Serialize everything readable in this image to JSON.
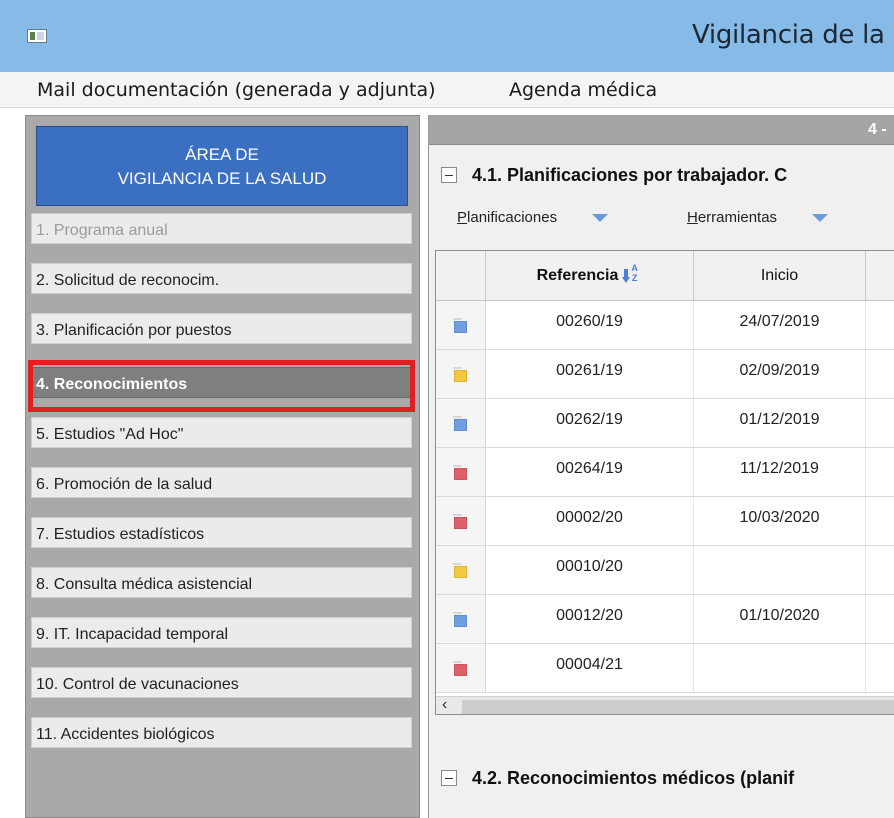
{
  "window": {
    "title": "Vigilancia de la"
  },
  "menu": [
    {
      "label": "Mail documentación (generada y adjunta)"
    },
    {
      "label": "Agenda médica"
    }
  ],
  "sidebar": {
    "header": {
      "line1": "ÁREA DE",
      "line2": "VIGILANCIA DE LA SALUD"
    },
    "items": [
      {
        "label": "1. Programa anual",
        "state": "disabled"
      },
      {
        "label": "2. Solicitud de reconocim.",
        "state": "normal"
      },
      {
        "label": "3. Planificación por puestos",
        "state": "normal"
      },
      {
        "label": "4. Reconocimientos",
        "state": "selected"
      },
      {
        "label": "5. Estudios \"Ad Hoc\"",
        "state": "normal"
      },
      {
        "label": "6. Promoción de la salud",
        "state": "normal"
      },
      {
        "label": "7. Estudios estadísticos",
        "state": "normal"
      },
      {
        "label": "8. Consulta médica asistencial",
        "state": "normal"
      },
      {
        "label": "9. IT. Incapacidad temporal",
        "state": "normal"
      },
      {
        "label": "10. Control de vacunaciones",
        "state": "normal"
      },
      {
        "label": "11. Accidentes biológicos",
        "state": "normal"
      }
    ],
    "highlight_color": "#e02020"
  },
  "main": {
    "header_text": "4 -",
    "section1": {
      "title": "4.1. Planificaciones por trabajador. C",
      "toolbar": [
        {
          "label": "Planificaciones",
          "accel": "P"
        },
        {
          "label": "Herramientas",
          "accel": "H"
        }
      ]
    },
    "grid": {
      "columns": [
        "Referencia",
        "Inicio"
      ],
      "sorted_column": "Referencia",
      "sort_icon": "sort-ascending-icon",
      "rows": [
        {
          "ref": "00260/19",
          "inicio": "24/07/2019",
          "color": "#6f9fe0"
        },
        {
          "ref": "00261/19",
          "inicio": "02/09/2019",
          "color": "#f5c842"
        },
        {
          "ref": "00262/19",
          "inicio": "01/12/2019",
          "color": "#6f9fe0"
        },
        {
          "ref": "00264/19",
          "inicio": "11/12/2019",
          "color": "#e0606a"
        },
        {
          "ref": "00002/20",
          "inicio": "10/03/2020",
          "color": "#e0606a"
        },
        {
          "ref": "00010/20",
          "inicio": "",
          "color": "#f5c842"
        },
        {
          "ref": "00012/20",
          "inicio": "01/10/2020",
          "color": "#6f9fe0"
        },
        {
          "ref": "00004/21",
          "inicio": "",
          "color": "#e0606a"
        }
      ]
    },
    "section2": {
      "title": "4.2. Reconocimientos médicos (planif"
    }
  },
  "colors": {
    "titlebar": "#85bbe6",
    "area_header": "#3b6fc2",
    "selected_item": "#7f7f7f"
  }
}
